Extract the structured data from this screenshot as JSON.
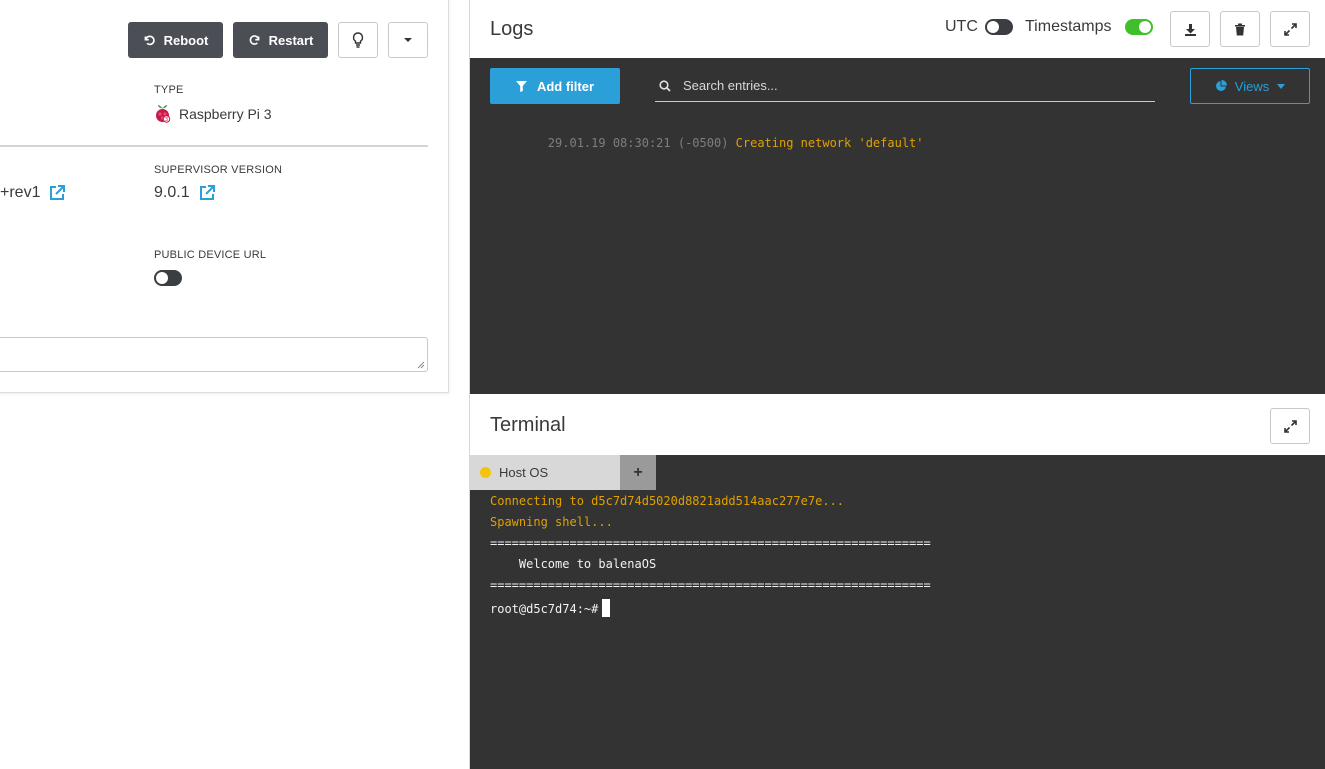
{
  "device_panel": {
    "reboot_label": "Reboot",
    "restart_label": "Restart",
    "type_label": "TYPE",
    "type_value": "Raspberry Pi 3",
    "os_version_partial": "+rev1",
    "supervisor_label": "SUPERVISOR VERSION",
    "supervisor_value": "9.0.1",
    "public_url_label": "PUBLIC DEVICE URL",
    "public_url_enabled": false
  },
  "logs": {
    "title": "Logs",
    "utc_label": "UTC",
    "utc_enabled": false,
    "timestamps_label": "Timestamps",
    "timestamps_enabled": true,
    "add_filter_label": "Add filter",
    "search_placeholder": "Search entries...",
    "views_label": "Views",
    "entries": [
      {
        "time": "29.01.19 08:30:21 (-0500)",
        "message": "Creating network 'default'"
      }
    ]
  },
  "terminal": {
    "title": "Terminal",
    "tab_label": "Host OS",
    "add_tab_label": "+",
    "lines": [
      "Connecting to d5c7d74d5020d8821add514aac277e7e...",
      "Spawning shell...",
      "=============================================================",
      "    Welcome to balenaOS",
      "=============================================================",
      "root@d5c7d74:~#"
    ]
  },
  "colors": {
    "accent": "#2a9fd8",
    "toggle_on": "#3fbf2a",
    "dark_button": "#4b4f55",
    "console_bg": "#333333",
    "log_yellow": "#e0a000",
    "status_dot": "#f2c40e"
  },
  "icons": {
    "reboot": "rotate-ccw-icon",
    "restart": "refresh-icon",
    "identify": "lightbulb-icon",
    "more": "caret-down-icon",
    "download": "download-icon",
    "clear": "trash-icon",
    "expand": "expand-icon",
    "filter": "filter-icon",
    "search": "search-icon",
    "views": "pie-chart-icon",
    "external": "external-link-icon",
    "device": "raspberry-pi-icon"
  }
}
